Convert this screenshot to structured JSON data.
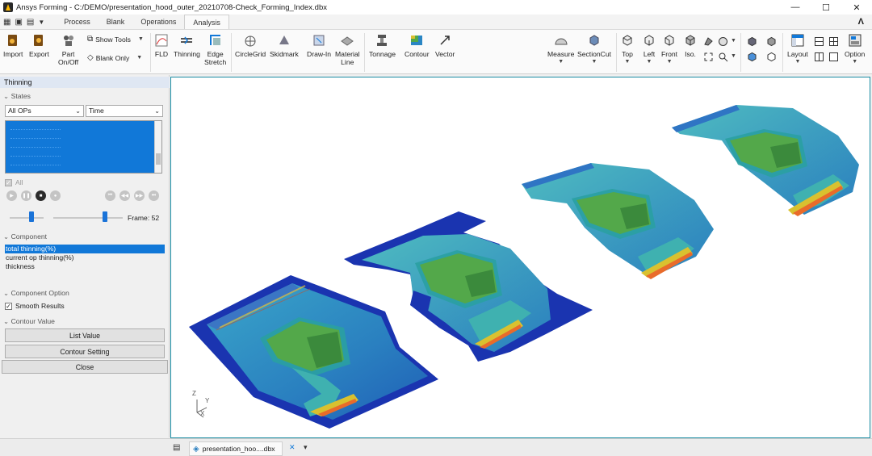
{
  "window": {
    "app_name": "Ansys Forming",
    "title_separator": " - ",
    "file_path": "C:/DEMO/presentation_hood_outer_20210708-Check_Forming_Index.dbx",
    "controls": [
      "—",
      "☐",
      "✕"
    ]
  },
  "menu_tabs": [
    "Process",
    "Blank",
    "Operations",
    "Analysis"
  ],
  "active_tab": "Analysis",
  "ribbon": {
    "import": "Import",
    "export": "Export",
    "part_onoff_1": "Part",
    "part_onoff_2": "On/Off",
    "show_tools": "Show Tools",
    "blank_only": "Blank Only",
    "fld": "FLD",
    "thinning": "Thinning",
    "edge_stretch_1": "Edge",
    "edge_stretch_2": "Stretch",
    "circle_grid": "CircleGrid",
    "skidmark": "Skidmark",
    "draw_in": "Draw-In",
    "material_line_1": "Material",
    "material_line_2": "Line",
    "tonnage": "Tonnage",
    "contour": "Contour",
    "vector": "Vector",
    "measure": "Measure",
    "section_cut": "SectionCut",
    "top": "Top",
    "left": "Left",
    "front": "Front",
    "iso": "Iso.",
    "layout": "Layout",
    "option": "Option"
  },
  "panel": {
    "title": "Thinning",
    "states_header": "States",
    "ops_select": "All OPs",
    "time_select": "Time",
    "all_checkbox": "All",
    "all_checked": true,
    "frame_label": "Frame:",
    "frame_value": "52",
    "component_header": "Component",
    "components": [
      "total thinning(%)",
      "current op thinning(%)",
      "thickness"
    ],
    "selected_component": "total thinning(%)",
    "component_option_header": "Component Option",
    "smooth_results": "Smooth Results",
    "smooth_checked": true,
    "contour_value_header": "Contour Value",
    "list_value": "List Value",
    "contour_setting": "Contour Setting",
    "close": "Close"
  },
  "viewport": {
    "axis_z": "Z",
    "axis_y": "Y",
    "axis_x": "X"
  },
  "bottom": {
    "doc_tab": "presentation_hoo....dbx",
    "close_glyph": "✕",
    "menu_glyph": "▾"
  },
  "colors": {
    "accent": "#1178d8",
    "viewport_border": "#1a8ca3",
    "blank_blue": "#1a34b0",
    "part_cyan": "#2a86c4",
    "part_teal": "#1e9a9b",
    "part_green": "#53a84a",
    "part_yellow": "#d9c12f"
  }
}
